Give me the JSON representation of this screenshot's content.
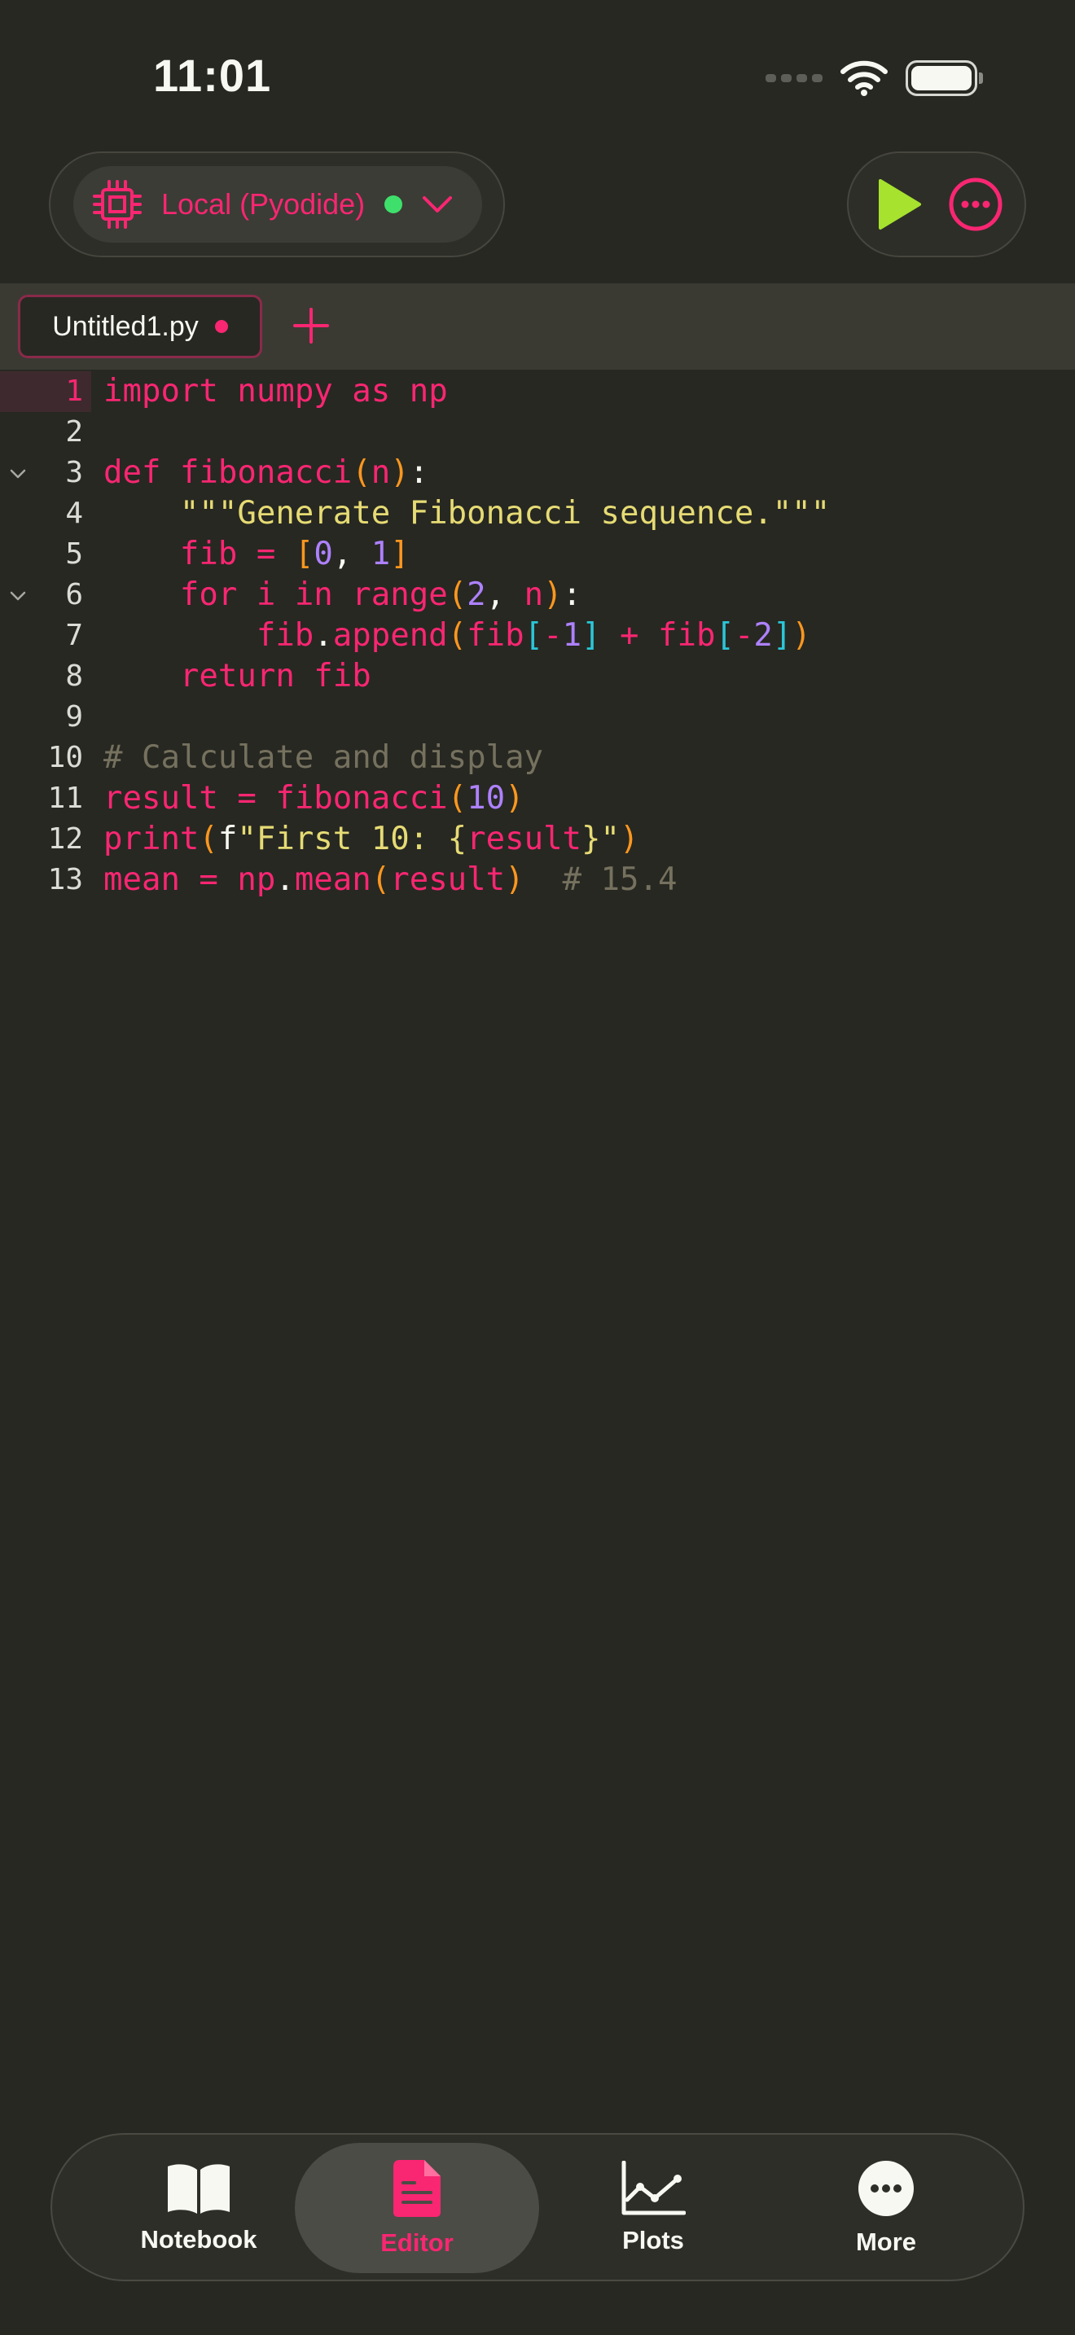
{
  "status_bar": {
    "time": "11:01"
  },
  "toolbar": {
    "kernel_label": "Local (Pyodide)",
    "kernel_status_color": "#3ee06b",
    "accent_color": "#f92672",
    "run_color": "#a6e22e"
  },
  "tabs": [
    {
      "label": "Untitled1.py",
      "modified": true
    }
  ],
  "editor": {
    "current_line": 1,
    "line_numbers": [
      "1",
      "2",
      "3",
      "4",
      "5",
      "6",
      "7",
      "8",
      "9",
      "10",
      "11",
      "12",
      "13"
    ],
    "lines": [
      "import numpy as np",
      "",
      "def fibonacci(n):",
      "    \"\"\"Generate Fibonacci sequence.\"\"\"",
      "    fib = [0, 1]",
      "    for i in range(2, n):",
      "        fib.append(fib[-1] + fib[-2])",
      "    return fib",
      "",
      "# Calculate and display",
      "result = fibonacci(10)",
      "print(f\"First 10: {result}\")",
      "mean = np.mean(result)  # 15.4"
    ],
    "foldable_lines": [
      3,
      6
    ]
  },
  "bottom_nav": {
    "items": [
      {
        "label": "Notebook",
        "icon": "book-icon"
      },
      {
        "label": "Editor",
        "icon": "document-icon",
        "active": true
      },
      {
        "label": "Plots",
        "icon": "line-chart-icon"
      },
      {
        "label": "More",
        "icon": "more-icon"
      }
    ]
  }
}
